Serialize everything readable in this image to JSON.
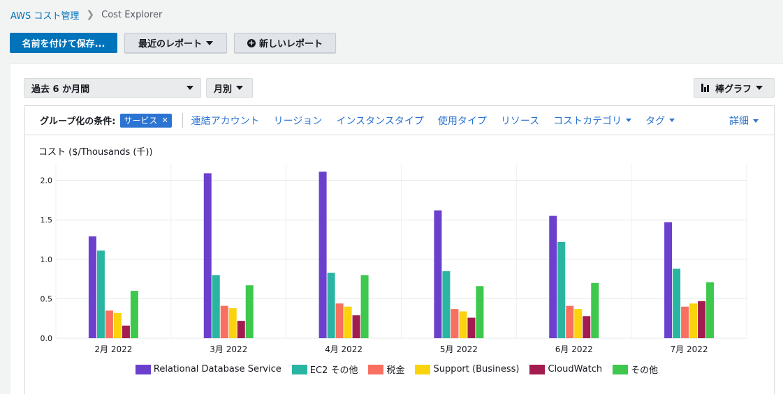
{
  "breadcrumb": {
    "root": "AWS コスト管理",
    "current": "Cost Explorer"
  },
  "toolbar": {
    "save_label": "名前を付けて保存...",
    "recent_label": "最近のレポート",
    "new_label": "新しいレポート"
  },
  "filters": {
    "range": "過去 6 か月間",
    "granularity": "月別",
    "chart_type": "棒グラフ"
  },
  "group_by": {
    "label": "グループ化の条件:",
    "selected_tag": "サービス",
    "options": [
      "連結アカウント",
      "リージョン",
      "インスタンスタイプ",
      "使用タイプ",
      "リソース",
      "コストカテゴリ",
      "タグ"
    ],
    "detail": "詳細"
  },
  "colors": {
    "primary": "#0073bb",
    "link": "#2b74d1"
  },
  "chart_data": {
    "type": "bar",
    "ylabel": "コスト ($/Thousands (千))",
    "ylim": [
      0,
      2.2
    ],
    "yticks": [
      "0.0",
      "0.5",
      "1.0",
      "1.5",
      "2.0"
    ],
    "categories": [
      "2月 2022",
      "3月 2022",
      "4月 2022",
      "5月 2022",
      "6月 2022",
      "7月 2022"
    ],
    "series": [
      {
        "name": "Relational Database Service",
        "color": "#6b40cd",
        "values": [
          1.29,
          2.09,
          2.11,
          1.62,
          1.55,
          1.47
        ]
      },
      {
        "name": "EC2 その他",
        "color": "#2ab5a2",
        "values": [
          1.11,
          0.8,
          0.83,
          0.85,
          1.22,
          0.88
        ]
      },
      {
        "name": "税金",
        "color": "#f97060",
        "values": [
          0.35,
          0.41,
          0.44,
          0.37,
          0.41,
          0.4
        ]
      },
      {
        "name": "Support (Business)",
        "color": "#fbd30c",
        "values": [
          0.32,
          0.38,
          0.4,
          0.34,
          0.37,
          0.44
        ]
      },
      {
        "name": "CloudWatch",
        "color": "#a31c4f",
        "values": [
          0.16,
          0.22,
          0.29,
          0.26,
          0.28,
          0.47
        ]
      },
      {
        "name": "その他",
        "color": "#3ec84d",
        "values": [
          0.6,
          0.67,
          0.8,
          0.66,
          0.7,
          0.71
        ]
      }
    ]
  }
}
